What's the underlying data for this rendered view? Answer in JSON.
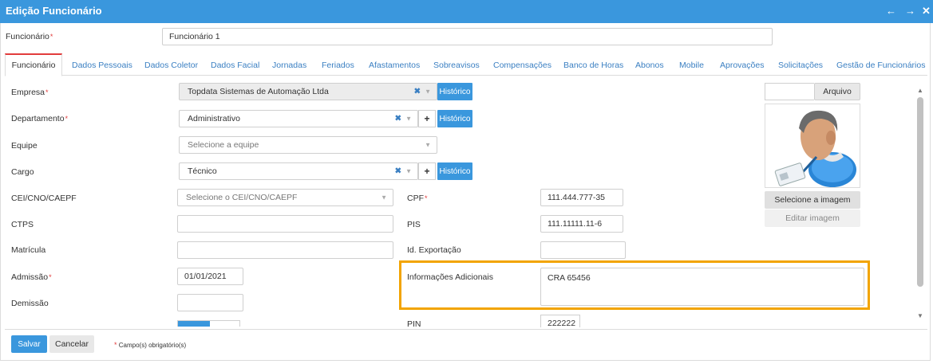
{
  "window": {
    "title": "Edição Funcionário"
  },
  "header": {
    "employee_label": "Funcionário",
    "employee_value": "Funcionário 1"
  },
  "tabs": [
    "Funcionário",
    "Dados Pessoais",
    "Dados Coletor",
    "Dados Facial",
    "Jornadas",
    "Feriados",
    "Afastamentos",
    "Sobreavisos",
    "Compensações",
    "Banco de Horas",
    "Abonos",
    "Mobile",
    "Aprovações",
    "Solicitações",
    "Gestão de Funcionários"
  ],
  "form": {
    "empresa": {
      "label": "Empresa",
      "value": "Topdata Sistemas de Automação Ltda",
      "historico": "Histórico"
    },
    "departamento": {
      "label": "Departamento",
      "value": "Administrativo",
      "plus": "+",
      "historico": "Histórico"
    },
    "equipe": {
      "label": "Equipe",
      "placeholder": "Selecione a equipe"
    },
    "cargo": {
      "label": "Cargo",
      "value": "Técnico",
      "plus": "+",
      "historico": "Histórico"
    },
    "cei": {
      "label": "CEI/CNO/CAEPF",
      "placeholder": "Selecione o CEI/CNO/CAEPF"
    },
    "cpf": {
      "label": "CPF",
      "value": "111.444.777-35"
    },
    "ctps": {
      "label": "CTPS",
      "value": ""
    },
    "pis": {
      "label": "PIS",
      "value": "111.11111.11-6"
    },
    "matricula": {
      "label": "Matrícula",
      "value": ""
    },
    "id_exportacao": {
      "label": "Id. Exportação",
      "value": ""
    },
    "admissao": {
      "label": "Admissão",
      "value": "01/01/2021"
    },
    "informacoes": {
      "label": "Informações Adicionais",
      "value": "CRA 65456"
    },
    "demissao": {
      "label": "Demissão",
      "value": ""
    },
    "pin": {
      "label": "PIN",
      "value": "222222"
    }
  },
  "photo": {
    "file_button": "Arquivo",
    "select_image": "Selecione a imagem",
    "edit_image": "Editar imagem"
  },
  "footer": {
    "save": "Salvar",
    "cancel": "Cancelar",
    "required_note": "Campo(s) obrigatório(s)",
    "required_mark": "*"
  },
  "colors": {
    "primary": "#3a97dd",
    "highlight": "#f2a400",
    "required": "#e23c3c"
  }
}
